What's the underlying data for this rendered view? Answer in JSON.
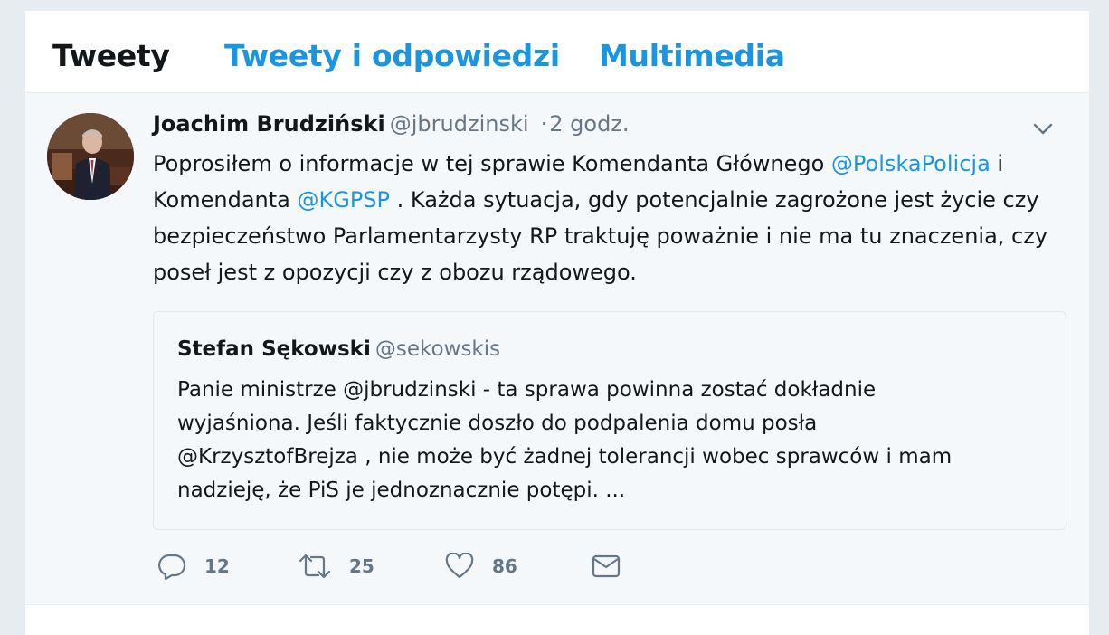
{
  "tabs": [
    {
      "label": "Tweety",
      "active": true
    },
    {
      "label": "Tweety i odpowiedzi",
      "active": false
    },
    {
      "label": "Multimedia",
      "active": false
    }
  ],
  "tweet": {
    "author_name": "Joachim Brudziński",
    "author_handle": "@jbrudzinski",
    "separator": "·",
    "time": "2 godz.",
    "text_parts": {
      "p1": "Poprosiłem o informacje w tej sprawie Komendanta Głównego ",
      "m1": "@PolskaPolicja",
      "p2": " i Komendanta ",
      "m2": "@KGPSP",
      "p3": " . Każda sytuacja, gdy potencjalnie zagrożone jest życie czy bezpieczeństwo Parlamentarzysty RP traktuję poważnie i nie ma tu znaczenia, czy poseł jest z opozycji czy z obozu rządowego."
    },
    "quoted": {
      "author_name": "Stefan Sękowski",
      "author_handle": "@sekowskis",
      "text": "Panie ministrze @jbrudzinski - ta sprawa powinna zostać dokładnie wyjaśniona. Jeśli faktycznie doszło do podpalenia domu posła @KrzysztofBrejza , nie może być żadnej tolerancji wobec sprawców i mam nadzieję, że PiS je jednoznacznie potępi.  ..."
    },
    "actions": {
      "replies": "12",
      "retweets": "25",
      "likes": "86"
    }
  },
  "icons": {
    "reply": "reply-icon",
    "retweet": "retweet-icon",
    "like": "heart-icon",
    "message": "envelope-icon",
    "menu": "chevron-down-icon"
  },
  "colors": {
    "link": "#1b95e0",
    "text": "#14171a",
    "muted": "#657786",
    "tweet_bg": "#f5f8fa"
  }
}
